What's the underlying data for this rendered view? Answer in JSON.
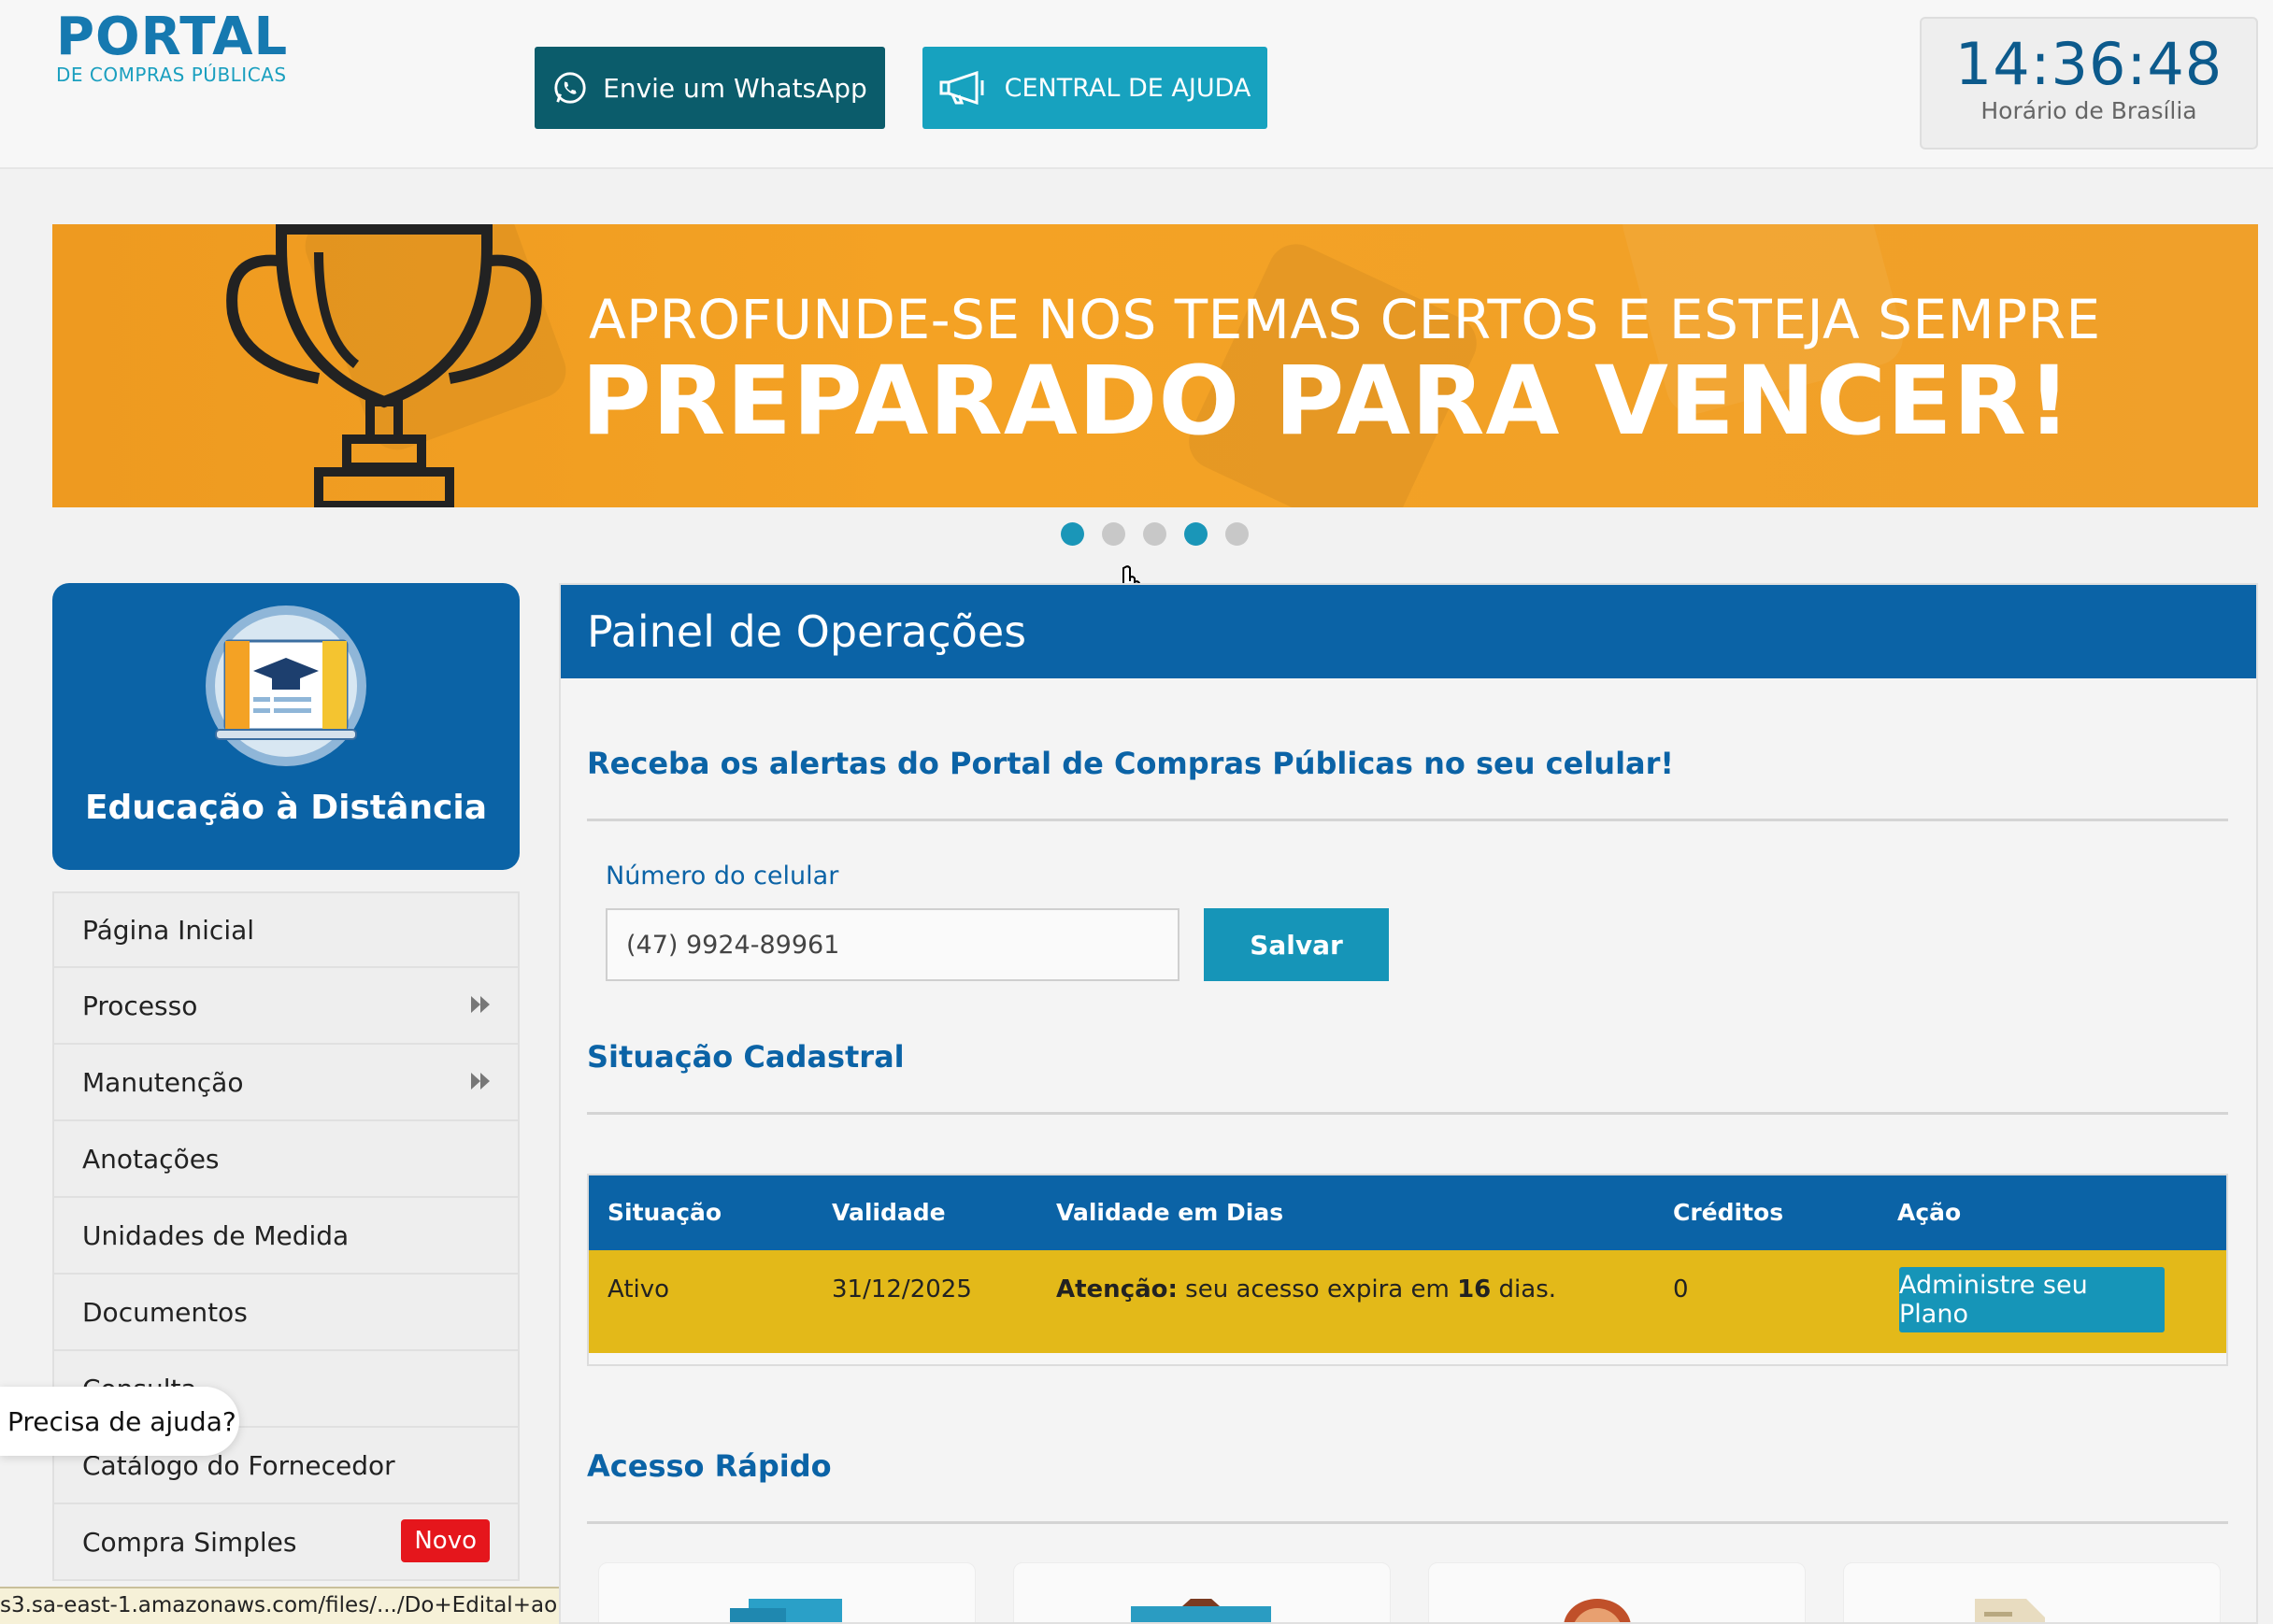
{
  "header": {
    "logo_main": "PORTAL",
    "logo_sub": "DE COMPRAS PÚBLICAS",
    "whatsapp_label": "Envie um WhatsApp",
    "help_label": "CENTRAL DE AJUDA",
    "clock_time": "14:36:48",
    "clock_label": "Horário de Brasília"
  },
  "banner": {
    "line1": "APROFUNDE-SE NOS TEMAS CERTOS E ESTEJA SEMPRE",
    "line2": "PREPARADO PARA VENCER!",
    "dots": 5
  },
  "sidebar": {
    "ead_label": "Educação à Distância",
    "items": [
      {
        "label": "Página Inicial"
      },
      {
        "label": "Processo"
      },
      {
        "label": "Manutenção"
      },
      {
        "label": "Anotações"
      },
      {
        "label": "Unidades de Medida"
      },
      {
        "label": "Documentos"
      },
      {
        "label": "Consulta"
      },
      {
        "label": "Catálogo do Fornecedor"
      },
      {
        "label": "Compra Simples",
        "badge": "Novo"
      }
    ],
    "help_bubble": "Precisa de ajuda?"
  },
  "status_url": "s3.sa-east-1.amazonaws.com/files/.../Do+Edital+ao+contrato.pdf",
  "panel": {
    "title": "Painel de Operações",
    "alerts_title": "Receba os alertas do Portal de Compras Públicas no seu celular!",
    "phone_label": "Número do celular",
    "phone_value": "(47) 9924-89961",
    "save_label": "Salvar",
    "status_title": "Situação Cadastral",
    "table": {
      "headers": [
        "Situação",
        "Validade",
        "Validade em Dias",
        "Créditos",
        "Ação"
      ],
      "row": {
        "situacao": "Ativo",
        "validade": "31/12/2025",
        "attention_prefix": "Atenção:",
        "attention_text": " seu acesso expira em ",
        "attention_days": "16",
        "attention_suffix": " dias.",
        "creditos": "0",
        "action_label": "Administre seu Plano"
      }
    },
    "quick_title": "Acesso Rápido"
  },
  "colors": {
    "primary": "#0b63a6",
    "accent": "#1695b8",
    "whatsapp": "#0b5c6b",
    "warning_row": "#e3b919",
    "banner": "#f4a224",
    "badge": "#e5161c"
  }
}
